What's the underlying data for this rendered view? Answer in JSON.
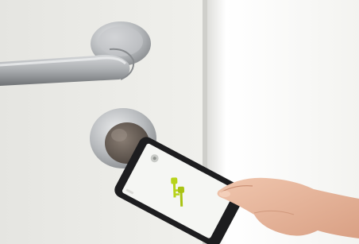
{
  "scene": {
    "description_free": true,
    "door_color": "#eeeeea",
    "frame_color": "#f4f4f1",
    "metal_color": "#b9bcbf",
    "cylinder_color": "#6b5f57",
    "phone_body_color": "#1d1d1f",
    "phone_screen_color": "#f5f6f3",
    "key_icon_color": "#b7d31a",
    "skin_color": "#e6b49b"
  },
  "phone": {
    "icon": "key-icon",
    "app_icon": "lock-app-icon"
  }
}
